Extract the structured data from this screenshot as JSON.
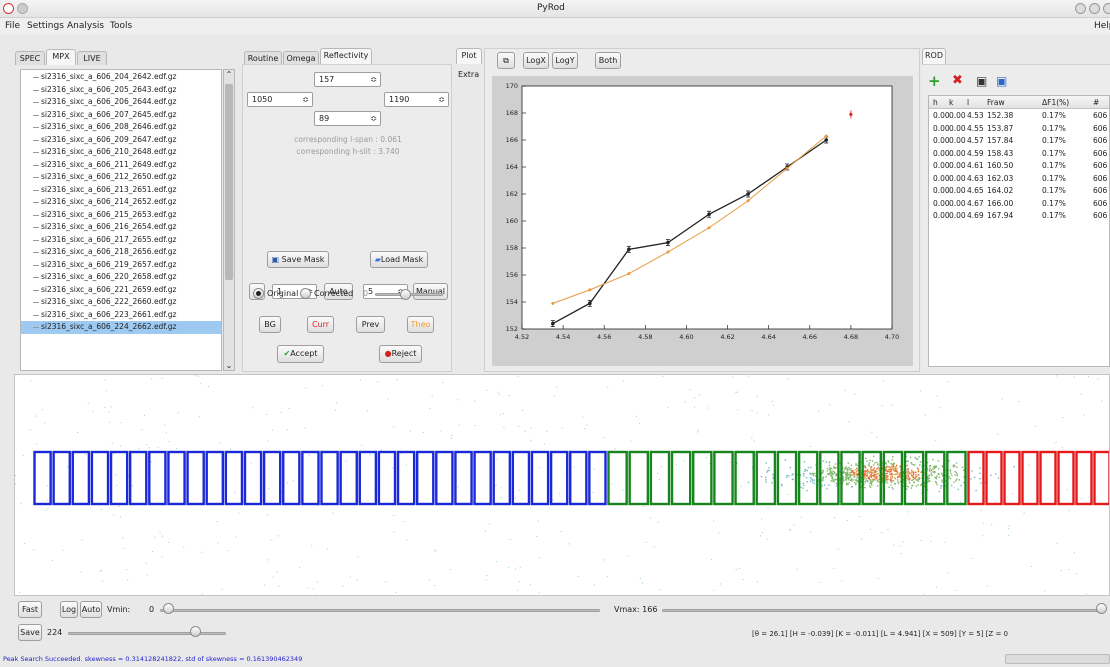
{
  "window": {
    "title": "PyRod",
    "help": "Help"
  },
  "menu": [
    "File",
    "Settings",
    "Analysis",
    "Tools"
  ],
  "left_tabs": [
    "SPEC",
    "MPX",
    "LIVE"
  ],
  "files": [
    "si2316_sixc_a_606_204_2642.edf.gz",
    "si2316_sixc_a_606_205_2643.edf.gz",
    "si2316_sixc_a_606_206_2644.edf.gz",
    "si2316_sixc_a_606_207_2645.edf.gz",
    "si2316_sixc_a_606_208_2646.edf.gz",
    "si2316_sixc_a_606_209_2647.edf.gz",
    "si2316_sixc_a_606_210_2648.edf.gz",
    "si2316_sixc_a_606_211_2649.edf.gz",
    "si2316_sixc_a_606_212_2650.edf.gz",
    "si2316_sixc_a_606_213_2651.edf.gz",
    "si2316_sixc_a_606_214_2652.edf.gz",
    "si2316_sixc_a_606_215_2653.edf.gz",
    "si2316_sixc_a_606_216_2654.edf.gz",
    "si2316_sixc_a_606_217_2655.edf.gz",
    "si2316_sixc_a_606_218_2656.edf.gz",
    "si2316_sixc_a_606_219_2657.edf.gz",
    "si2316_sixc_a_606_220_2658.edf.gz",
    "si2316_sixc_a_606_221_2659.edf.gz",
    "si2316_sixc_a_606_222_2660.edf.gz",
    "si2316_sixc_a_606_223_2661.edf.gz",
    "si2316_sixc_a_606_224_2662.edf.gz"
  ],
  "mid_tabs": [
    "Routine",
    "Omega",
    "Reflectivity"
  ],
  "roi": {
    "top": "157",
    "left": "1050",
    "right": "1190",
    "bottom": "89"
  },
  "info": {
    "lspan": "corresponding l-span : 0.061",
    "hslit": "corresponding h-slit : 3.740"
  },
  "buttons": {
    "save_mask": "Save Mask",
    "load_mask": "Load Mask",
    "auto": "Auto",
    "manual": "Manual",
    "original": "Original",
    "corrected": "Corrected",
    "corr_val": "0",
    "bg": "BG",
    "curr": "Curr",
    "prev": "Prev",
    "theo": "Theo",
    "accept": "Accept",
    "reject": "Reject"
  },
  "bg_spin": "1",
  "manual_spin": "5",
  "plot_tabs": [
    "Plot",
    "Extra"
  ],
  "plot_toolbar": [
    "LogX",
    "LogY",
    "Both"
  ],
  "rod": {
    "tab": "ROD",
    "columns": [
      "h",
      "k",
      "l",
      "Fraw",
      "ΔF1(%)",
      "#"
    ],
    "rows": [
      [
        "0.00",
        "0.00",
        "4.53",
        "152.38",
        "0.17%",
        "606"
      ],
      [
        "0.00",
        "0.00",
        "4.55",
        "153.87",
        "0.17%",
        "606"
      ],
      [
        "0.00",
        "0.00",
        "4.57",
        "157.84",
        "0.17%",
        "606"
      ],
      [
        "0.00",
        "0.00",
        "4.59",
        "158.43",
        "0.17%",
        "606"
      ],
      [
        "0.00",
        "0.00",
        "4.61",
        "160.50",
        "0.17%",
        "606"
      ],
      [
        "0.00",
        "0.00",
        "4.63",
        "162.03",
        "0.17%",
        "606"
      ],
      [
        "0.00",
        "0.00",
        "4.65",
        "164.02",
        "0.17%",
        "606"
      ],
      [
        "0.00",
        "0.00",
        "4.67",
        "166.00",
        "0.17%",
        "606"
      ],
      [
        "0.00",
        "0.00",
        "4.69",
        "167.94",
        "0.17%",
        "606"
      ]
    ]
  },
  "bottom": {
    "fast": "Fast",
    "log": "Log",
    "auto": "Auto",
    "vmin_label": "Vmin:",
    "vmin": "0",
    "vmax": "Vmax: 166",
    "save": "Save",
    "save_val": "224",
    "coords": "[θ = 26.1]  [H = -0.039]  [K = -0.011]  [L = 4.941]  [X = 509]  [Y = 5]  [Z = 0"
  },
  "status": "Peak Search Succeeded. skewness = 0.314128241822, std of skewness = 0.161390462349",
  "colors": {
    "blue_roi": "#1a28d8",
    "green_roi": "#16861c",
    "red_roi": "#e41a1a",
    "measured": "#222222",
    "theory": "#e69a3c"
  },
  "chart_data": {
    "type": "line",
    "xlim": [
      4.52,
      4.7
    ],
    "ylim": [
      152,
      170
    ],
    "xticks": [
      "4.52",
      "4.54",
      "4.56",
      "4.58",
      "4.60",
      "4.62",
      "4.64",
      "4.66",
      "4.68",
      "4.70"
    ],
    "yticks": [
      "152",
      "154",
      "156",
      "158",
      "160",
      "162",
      "164",
      "166",
      "168",
      "170"
    ],
    "series": [
      {
        "x": [
          4.535,
          4.553,
          4.572,
          4.591,
          4.611,
          4.63,
          4.649,
          4.668
        ],
        "values": [
          152.4,
          153.9,
          157.9,
          158.4,
          160.5,
          162.0,
          164.0,
          166.0
        ]
      },
      {
        "x": [
          4.535,
          4.553,
          4.572,
          4.591,
          4.611,
          4.63,
          4.649,
          4.668
        ],
        "values": [
          153.9,
          154.9,
          156.1,
          157.7,
          159.5,
          161.5,
          163.9,
          166.3
        ]
      }
    ],
    "point": {
      "x": 4.68,
      "y": 167.9
    }
  }
}
